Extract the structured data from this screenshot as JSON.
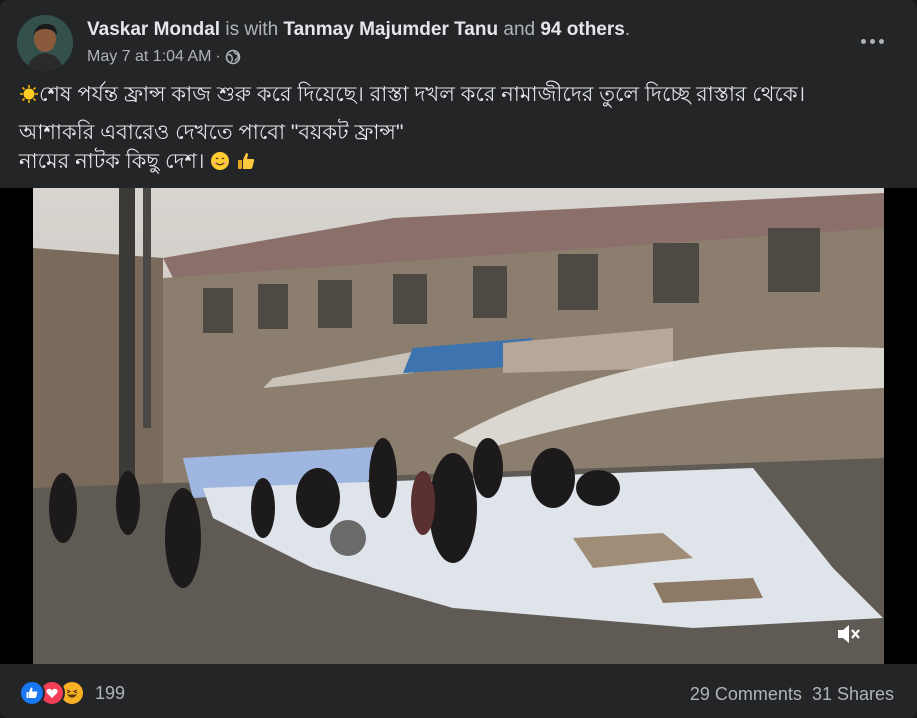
{
  "post": {
    "author": "Vaskar Mondal",
    "with_text": "is with",
    "tagged_user": "Tanmay Majumder Tanu",
    "and_text": "and",
    "others": "94 others",
    "period": ".",
    "date": "May 7 at 1:04 AM",
    "separator": "·",
    "privacy_icon": "globe-icon",
    "more_icon": "more-options-icon",
    "text_line1": "শেষ পর্যন্ত ফ্রান্স কাজ শুরু করে দিয়েছে। রাস্তা দখল করে নামাজীদের তুলে দিচ্ছে রাস্তার থেকে।",
    "text_line2": "আশাকরি এবারেও দেখতে পাবো \"বয়কট ফ্রান্স\"",
    "text_line3": "নামের নাটক কিছু দেশ।",
    "emoji_start": "sun-emoji",
    "emoji_end": [
      "smile-emoji",
      "thumbs-up-emoji"
    ]
  },
  "media": {
    "type": "video",
    "description_icon": "video-thumbnail",
    "mute_icon": "volume-muted-icon"
  },
  "footer": {
    "reaction_icons": [
      "like-icon",
      "love-icon",
      "haha-icon"
    ],
    "reaction_count": "199",
    "comments": "29 Comments",
    "shares": "31 Shares"
  },
  "colors": {
    "background": "#242526",
    "text_primary": "#e4e6eb",
    "text_secondary": "#b0b3b8",
    "like_blue": "#1877f2",
    "love_red": "#f33e58",
    "haha_yellow": "#f7b125"
  }
}
